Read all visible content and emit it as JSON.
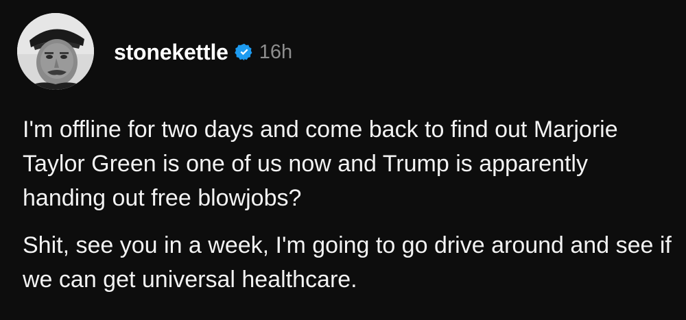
{
  "post": {
    "author": {
      "username": "stonekettle",
      "verified": true,
      "avatar_icon": "profile-photo-icon"
    },
    "timestamp": "16h",
    "paragraphs": [
      "I'm offline for two days and come back to find out Marjorie Taylor Green is one of us now and Trump is apparently handing out free blowjobs?",
      "Shit, see you in a week, I'm going to go drive around and see if we can get universal healthcare."
    ]
  },
  "colors": {
    "background": "#0d0d0d",
    "text": "#f3f3f3",
    "timestamp": "#8e8e8e",
    "verified_badge": "#1d9bf0"
  }
}
